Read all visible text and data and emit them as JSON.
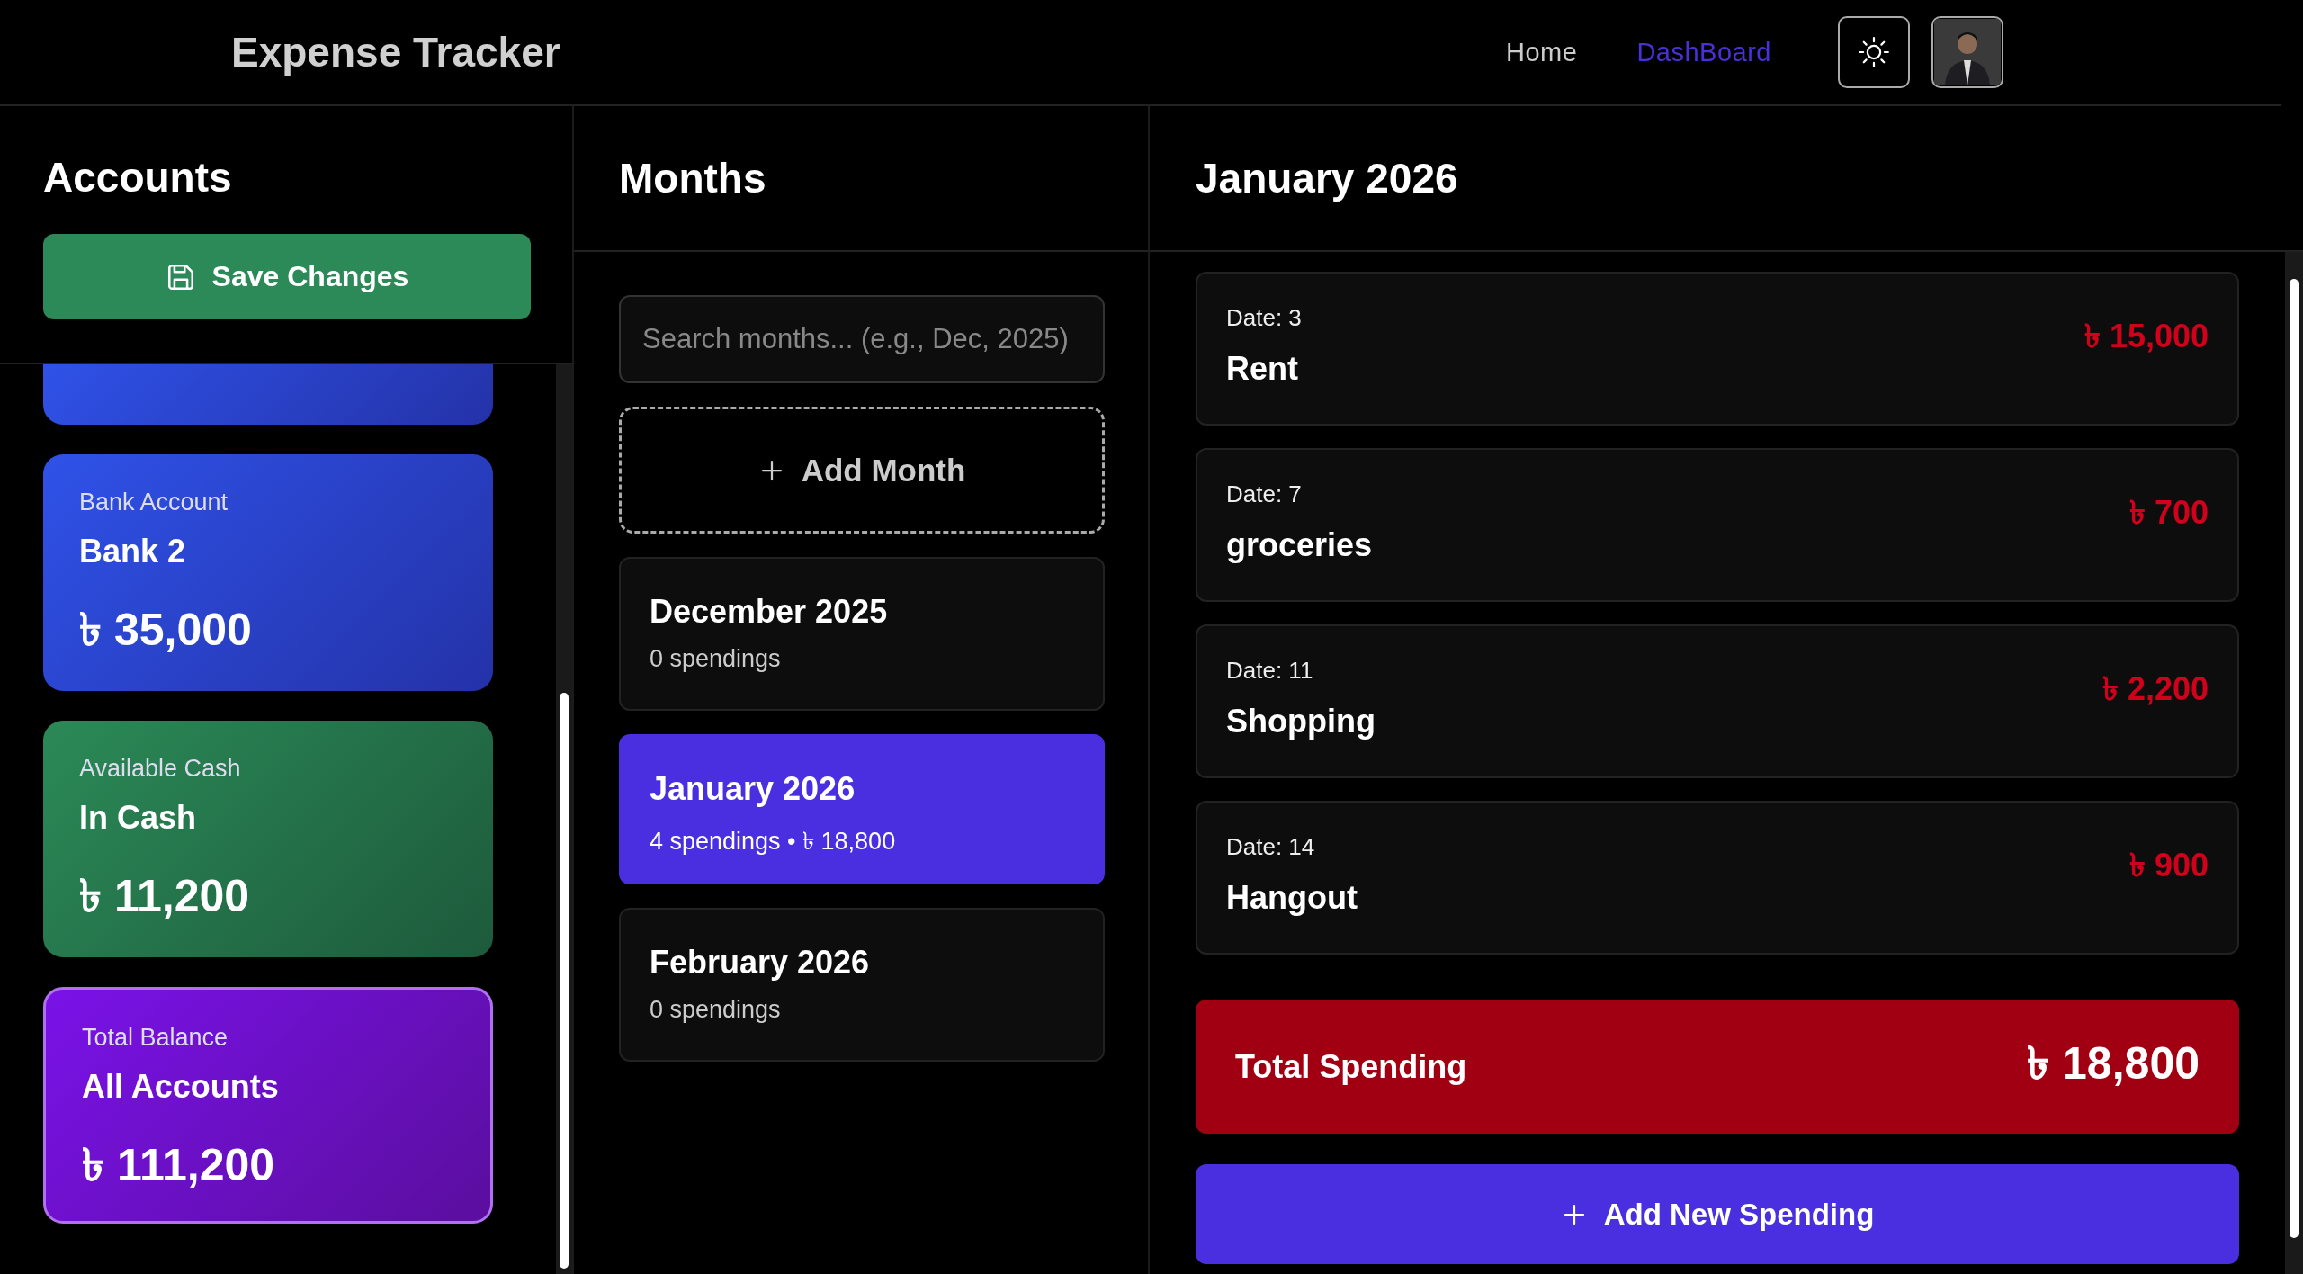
{
  "app_title": "Expense Tracker",
  "nav": [
    {
      "label": "Home",
      "selected": false
    },
    {
      "label": "DashBoard",
      "selected": true
    }
  ],
  "accounts_panel": {
    "title": "Accounts",
    "save_button": "Save Changes",
    "accounts": [
      {
        "kind": "bank",
        "type": "Bank Account",
        "name": "Bank 2",
        "amount": "৳ 35,000"
      },
      {
        "kind": "cash",
        "type": "Available Cash",
        "name": "In Cash",
        "amount": "৳ 11,200"
      },
      {
        "kind": "total",
        "type": "Total Balance",
        "name": "All Accounts",
        "amount": "৳ 111,200"
      }
    ]
  },
  "months_panel": {
    "title": "Months",
    "search": {
      "placeholder": "Search months... (e.g., Dec, 2025)"
    },
    "add_button": "Add Month",
    "months": [
      {
        "name": "December 2025",
        "summary": "0 spendings",
        "selected": false
      },
      {
        "name": "January 2026",
        "summary": "4 spendings • ৳ 18,800",
        "selected": true
      },
      {
        "name": "February 2026",
        "summary": "0 spendings",
        "selected": false
      }
    ]
  },
  "detail_panel": {
    "title": "January 2026",
    "spendings": [
      {
        "date": "Date: 3",
        "name": "Rent",
        "amount": "৳ 15,000"
      },
      {
        "date": "Date: 7",
        "name": "groceries",
        "amount": "৳ 700"
      },
      {
        "date": "Date: 11",
        "name": "Shopping",
        "amount": "৳ 2,200"
      },
      {
        "date": "Date: 14",
        "name": "Hangout",
        "amount": "৳ 900"
      }
    ],
    "total": {
      "label": "Total Spending",
      "amount": "৳ 18,800"
    },
    "add_button": "Add New Spending"
  }
}
